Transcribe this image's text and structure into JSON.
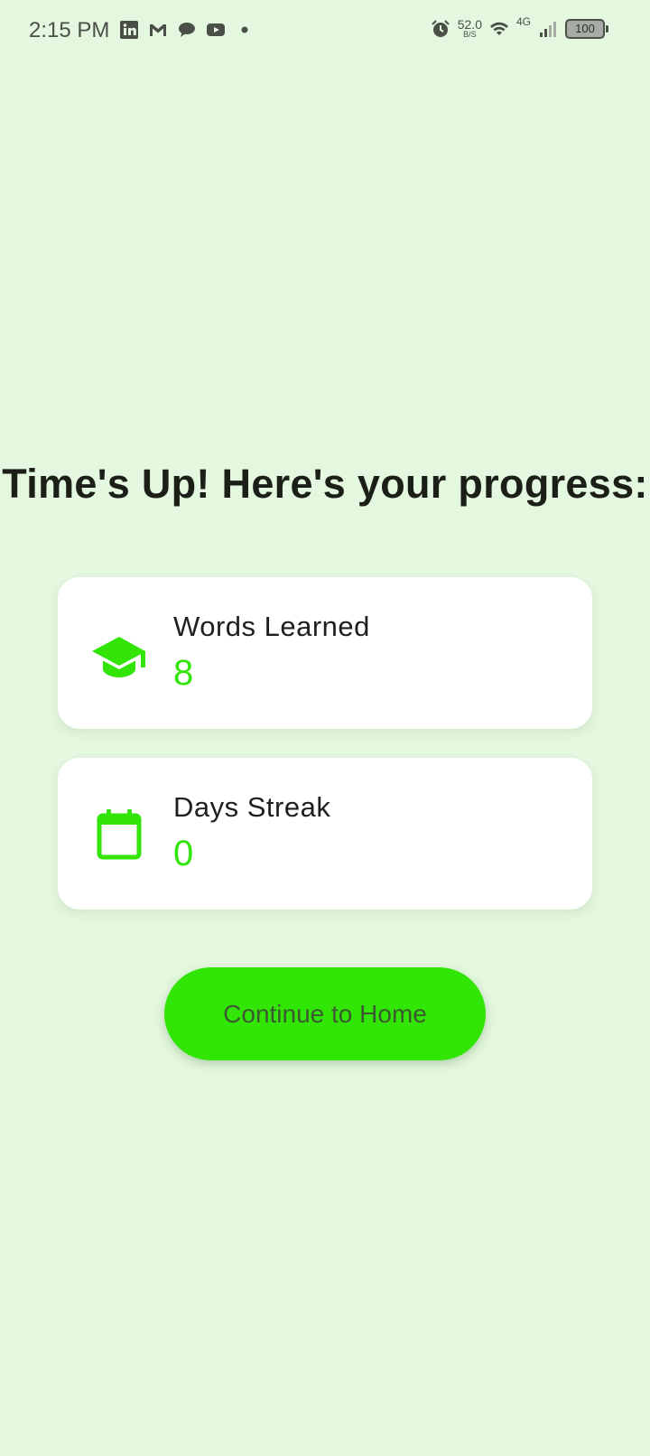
{
  "status_bar": {
    "time": "2:15 PM",
    "net_speed_value": "52.0",
    "net_speed_unit": "B/S",
    "network_type": "4G",
    "battery": "100",
    "left_icons": [
      "linkedin-icon",
      "gmail-icon",
      "chat-icon",
      "youtube-icon",
      "dot-icon"
    ],
    "right_icons": [
      "alarm-icon",
      "wifi-icon",
      "signal-icon",
      "battery-icon"
    ]
  },
  "main": {
    "headline": "Time's Up! Here's your progress:"
  },
  "stats": [
    {
      "icon": "graduation-cap-icon",
      "label": "Words Learned",
      "value": "8"
    },
    {
      "icon": "calendar-icon",
      "label": "Days Streak",
      "value": "0"
    }
  ],
  "actions": {
    "continue_label": "Continue to Home"
  },
  "colors": {
    "background": "#e4f7df",
    "accent": "#31e605",
    "value_text": "#32e407"
  }
}
